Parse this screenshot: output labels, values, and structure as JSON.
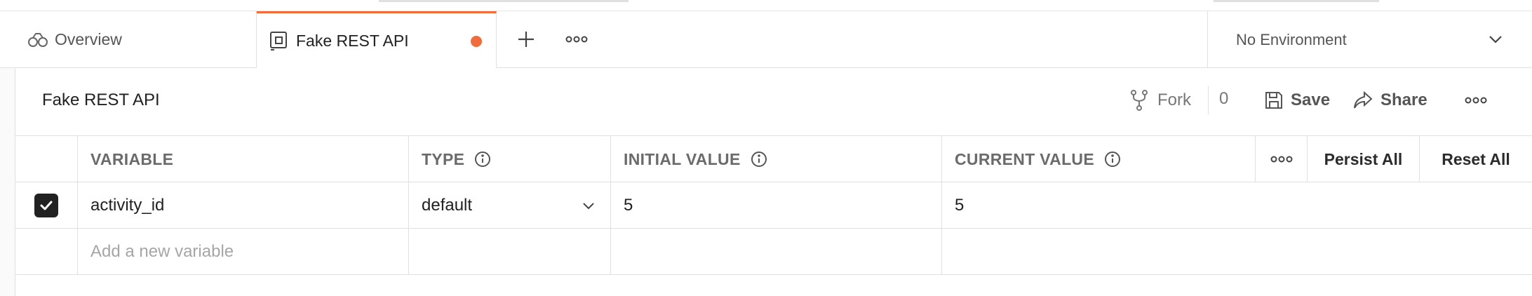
{
  "tabs": {
    "overview_label": "Overview",
    "active_label": "Fake REST API",
    "unsaved_color": "#f26b3a"
  },
  "environment": {
    "selected": "No Environment"
  },
  "header": {
    "title": "Fake REST API",
    "fork_label": "Fork",
    "fork_count": "0",
    "save_label": "Save",
    "share_label": "Share"
  },
  "table": {
    "columns": {
      "variable": "VARIABLE",
      "type": "TYPE",
      "initial_value": "INITIAL VALUE",
      "current_value": "CURRENT VALUE"
    },
    "persist_all_label": "Persist All",
    "reset_all_label": "Reset All",
    "rows": [
      {
        "checked": true,
        "variable": "activity_id",
        "type": "default",
        "initial_value": "5",
        "current_value": "5"
      }
    ],
    "new_variable_placeholder": "Add a new variable"
  },
  "colors": {
    "accent": "#f26b3a",
    "border": "#e0e0e0",
    "text": "#212121",
    "muted": "#6b6b6b"
  }
}
